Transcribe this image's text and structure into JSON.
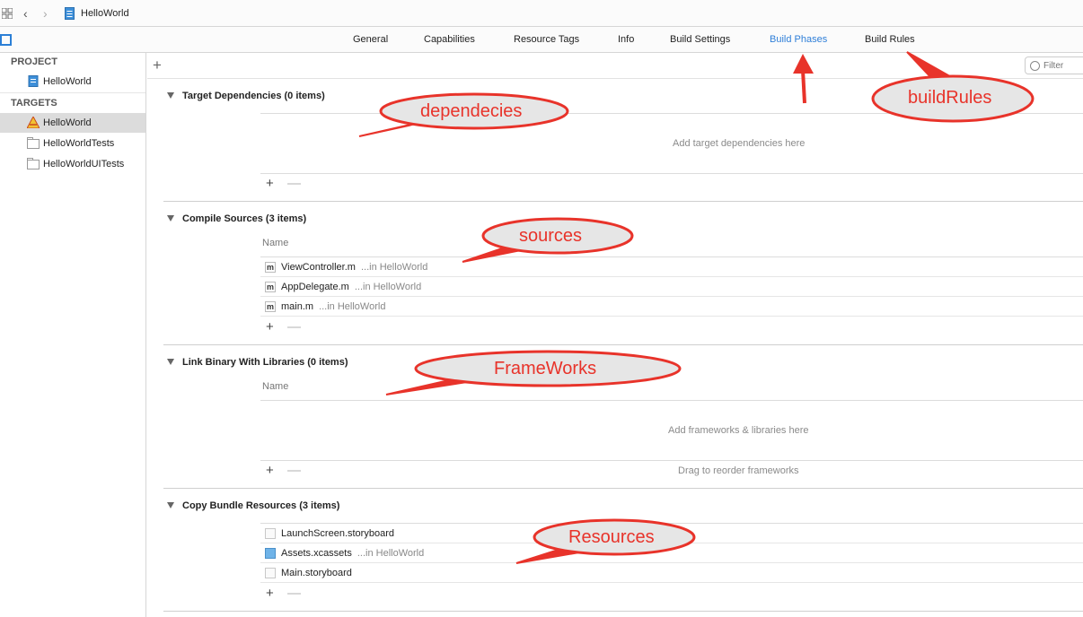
{
  "topbar": {
    "project_name": "HelloWorld"
  },
  "tabs": [
    {
      "label": "General"
    },
    {
      "label": "Capabilities"
    },
    {
      "label": "Resource Tags"
    },
    {
      "label": "Info"
    },
    {
      "label": "Build Settings"
    },
    {
      "label": "Build Phases",
      "active": true
    },
    {
      "label": "Build Rules"
    }
  ],
  "sidebar": {
    "project_header": "PROJECT",
    "project_item": "HelloWorld",
    "targets_header": "TARGETS",
    "targets": [
      {
        "label": "HelloWorld",
        "selected": true
      },
      {
        "label": "HelloWorldTests"
      },
      {
        "label": "HelloWorldUITests"
      }
    ]
  },
  "toolbar": {
    "add_symbol": "+",
    "filter_placeholder": "Filter"
  },
  "phases": {
    "dependencies": {
      "title": "Target Dependencies (0 items)",
      "placeholder": "Add target dependencies here"
    },
    "compile": {
      "title": "Compile Sources (3 items)",
      "column": "Name",
      "files": [
        {
          "name": "ViewController.m",
          "location": "...in HelloWorld"
        },
        {
          "name": "AppDelegate.m",
          "location": "...in HelloWorld"
        },
        {
          "name": "main.m",
          "location": "...in HelloWorld"
        }
      ]
    },
    "link": {
      "title": "Link Binary With Libraries (0 items)",
      "column": "Name",
      "placeholder": "Add frameworks & libraries here",
      "hint": "Drag to reorder frameworks"
    },
    "copy": {
      "title": "Copy Bundle Resources (3 items)",
      "files": [
        {
          "name": "LaunchScreen.storyboard",
          "location": ""
        },
        {
          "name": "Assets.xcassets",
          "location": "...in HelloWorld"
        },
        {
          "name": "Main.storyboard",
          "location": ""
        }
      ]
    }
  },
  "controls": {
    "plus": "+",
    "minus": "—"
  },
  "annotations": {
    "dependencies": "dependecies",
    "build_rules": "buildRules",
    "sources": "sources",
    "frameworks": "FrameWorks",
    "resources": "Resources"
  },
  "colors": {
    "accent": "#2f7fd8",
    "annotation_red": "#e8332a",
    "annotation_fill": "#e6e6e6"
  }
}
